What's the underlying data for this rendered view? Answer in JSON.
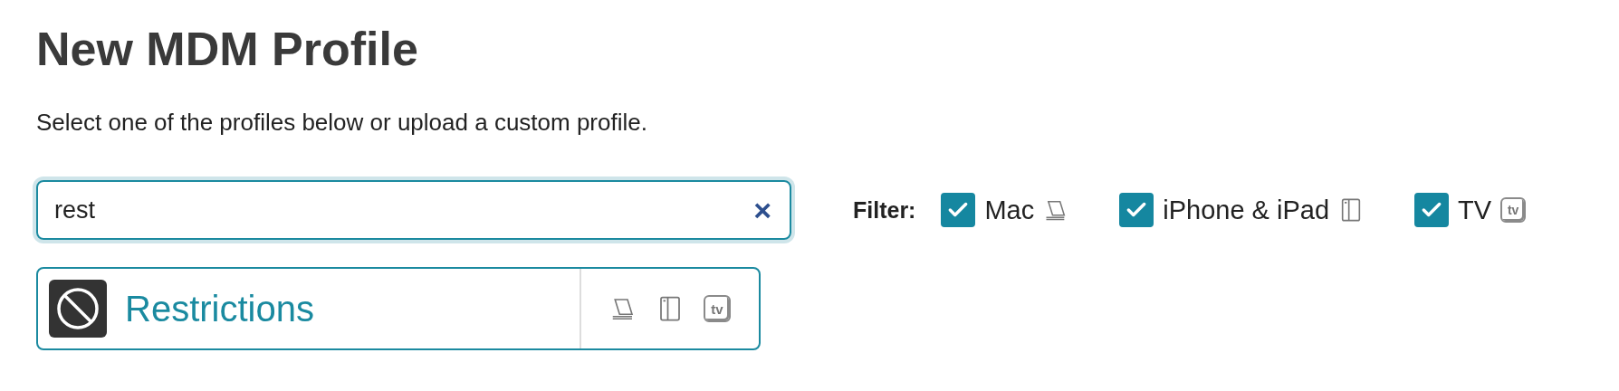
{
  "title": "New MDM Profile",
  "subtitle": "Select one of the profiles below or upload a custom profile.",
  "search": {
    "value": "rest",
    "clear": "×"
  },
  "filter": {
    "label": "Filter:",
    "options": [
      {
        "label": "Mac",
        "checked": true,
        "kind": "mac"
      },
      {
        "label": "iPhone & iPad",
        "checked": true,
        "kind": "iphone"
      },
      {
        "label": "TV",
        "checked": true,
        "kind": "tv",
        "badge": "tv"
      }
    ]
  },
  "results": [
    {
      "name": "Restrictions",
      "platforms": [
        {
          "kind": "mac"
        },
        {
          "kind": "iphone"
        },
        {
          "kind": "tv",
          "badge": "tv"
        }
      ]
    }
  ]
}
